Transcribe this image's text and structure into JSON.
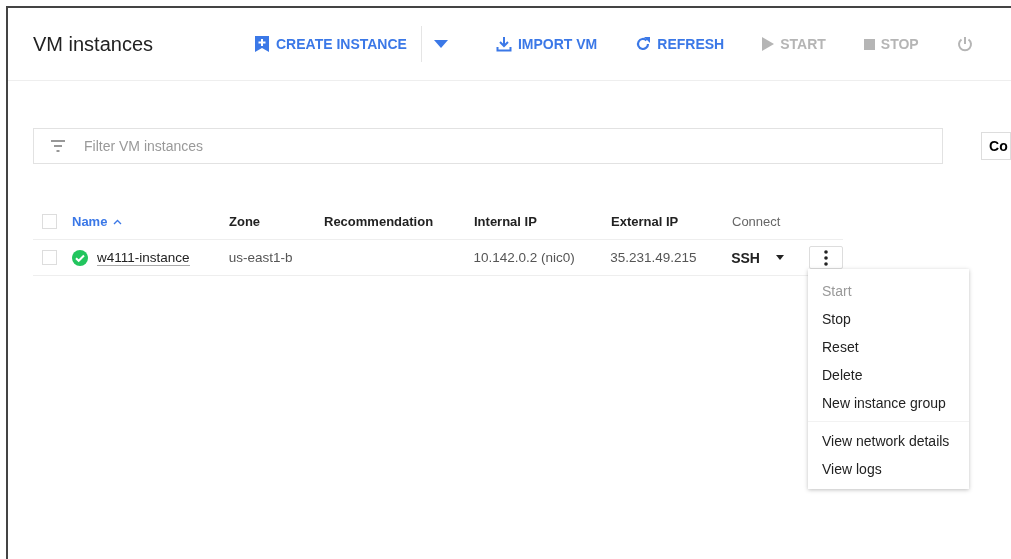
{
  "header": {
    "title": "VM instances"
  },
  "toolbar": [
    {
      "kind": "create",
      "label": "CREATE INSTANCE",
      "disabled": false
    },
    {
      "kind": "dropdown",
      "disabled": false
    },
    {
      "kind": "import",
      "label": "IMPORT VM",
      "disabled": false
    },
    {
      "kind": "refresh",
      "label": "REFRESH",
      "disabled": false
    },
    {
      "kind": "start",
      "label": "START",
      "disabled": true
    },
    {
      "kind": "stop",
      "label": "STOP",
      "disabled": true
    },
    {
      "kind": "power",
      "disabled": true
    }
  ],
  "filter": {
    "placeholder": "Filter VM instances"
  },
  "side_button": {
    "label": "Co"
  },
  "table": {
    "all_checked": false,
    "columns": [
      {
        "label": "Name",
        "sorted": true
      },
      {
        "label": "Zone",
        "sorted": false
      },
      {
        "label": "Recommendation",
        "sorted": false
      },
      {
        "label": "Internal IP",
        "sorted": false
      },
      {
        "label": "External IP",
        "sorted": false
      },
      {
        "label": "Connect",
        "sorted": false
      }
    ],
    "rows": [
      {
        "checked": false,
        "healthy": true,
        "name": "w4111-instance",
        "zone": "us-east1-b",
        "internal_ip": "10.142.0.2 (nic0)",
        "external_ip": "35.231.49.215",
        "connect": "SSH"
      }
    ]
  },
  "menu": {
    "groups": [
      [
        {
          "label": "Start",
          "disabled": true
        },
        {
          "label": "Stop",
          "disabled": false
        },
        {
          "label": "Reset",
          "disabled": false
        },
        {
          "label": "Delete",
          "disabled": false
        },
        {
          "label": "New instance group",
          "disabled": false
        }
      ],
      [
        {
          "label": "View network details",
          "disabled": false
        },
        {
          "label": "View logs",
          "disabled": false
        }
      ]
    ]
  }
}
